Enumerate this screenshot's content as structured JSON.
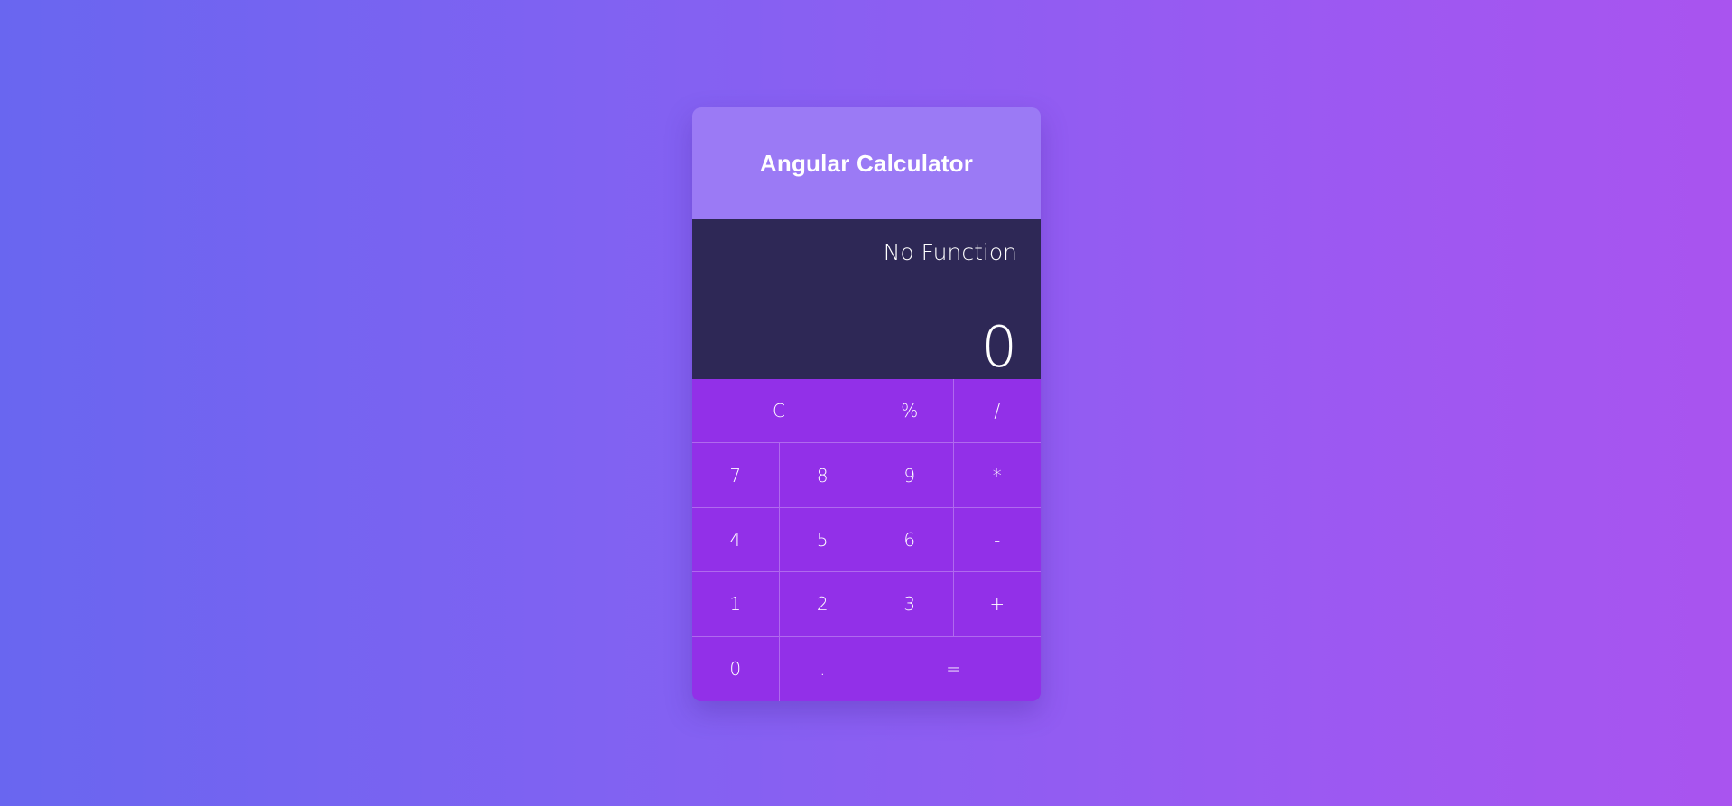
{
  "app": {
    "title": "Angular Calculator"
  },
  "display": {
    "function_label": "No Function",
    "value": "0"
  },
  "keys": {
    "clear": "C",
    "percent": "%",
    "divide": "/",
    "seven": "7",
    "eight": "8",
    "nine": "9",
    "multiply": "*",
    "four": "4",
    "five": "5",
    "six": "6",
    "subtract": "-",
    "one": "1",
    "two": "2",
    "three": "3",
    "add": "+",
    "zero": "0",
    "decimal": ".",
    "equals": "="
  },
  "colors": {
    "header": "#9b7af5",
    "display": "#2e2856",
    "keypad": "#9230e8",
    "text": "#ffffff"
  }
}
